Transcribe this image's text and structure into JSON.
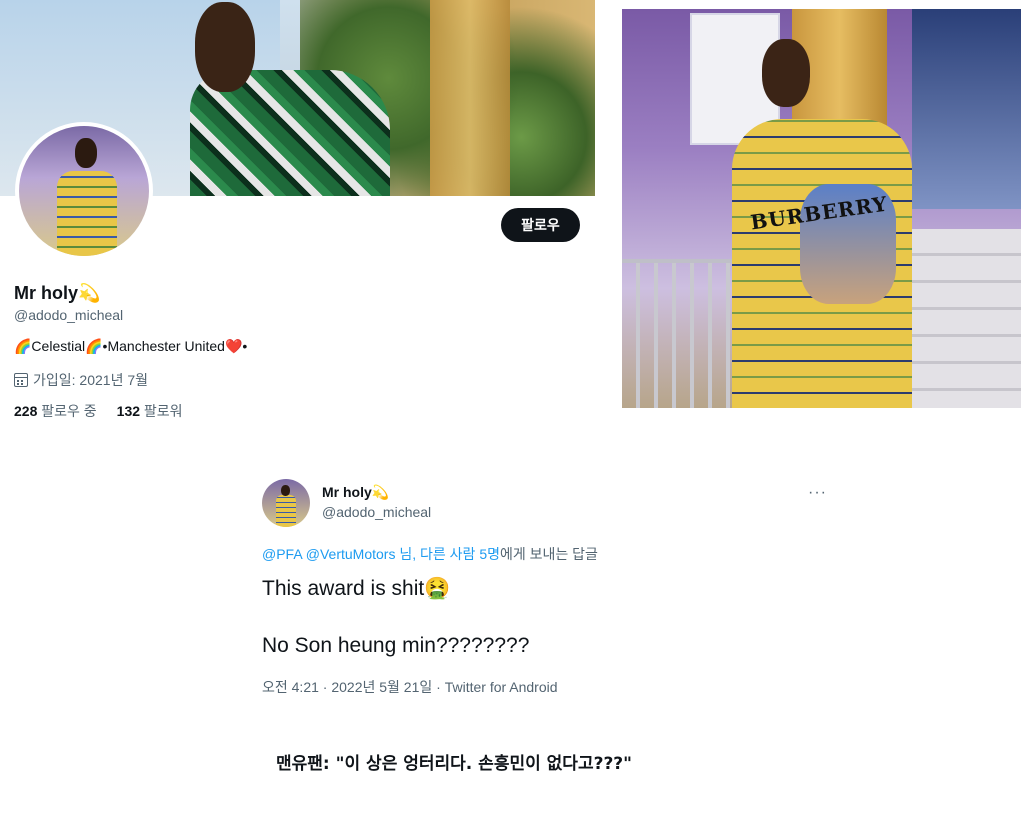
{
  "profile": {
    "follow_button": "팔로우",
    "display_name": "Mr holy",
    "name_emoji": "💫",
    "handle": "@adodo_micheal",
    "bio": "🌈Celestial🌈•Manchester United❤️•",
    "joined": "가입일: 2021년 7월",
    "following_count": "228",
    "following_label": "팔로우 중",
    "followers_count": "132",
    "followers_label": "팔로워"
  },
  "tweet": {
    "display_name": "Mr holy",
    "name_emoji": "💫",
    "handle": "@adodo_micheal",
    "more_icon": "···",
    "reply_mentions": "@PFA @VertuMotors  님, 다른 사람 5명",
    "reply_suffix": "에게 보내는 답글",
    "line1": "This award is shit🤮",
    "line2": "No Son heung min????????",
    "meta": "오전 4:21 · 2022년 5월 21일 · Twitter for Android"
  },
  "photo": {
    "shirt_text": "BURBERRY"
  },
  "caption": "맨유팬: \"이 상은 엉터리다. 손흥민이 없다고???\""
}
